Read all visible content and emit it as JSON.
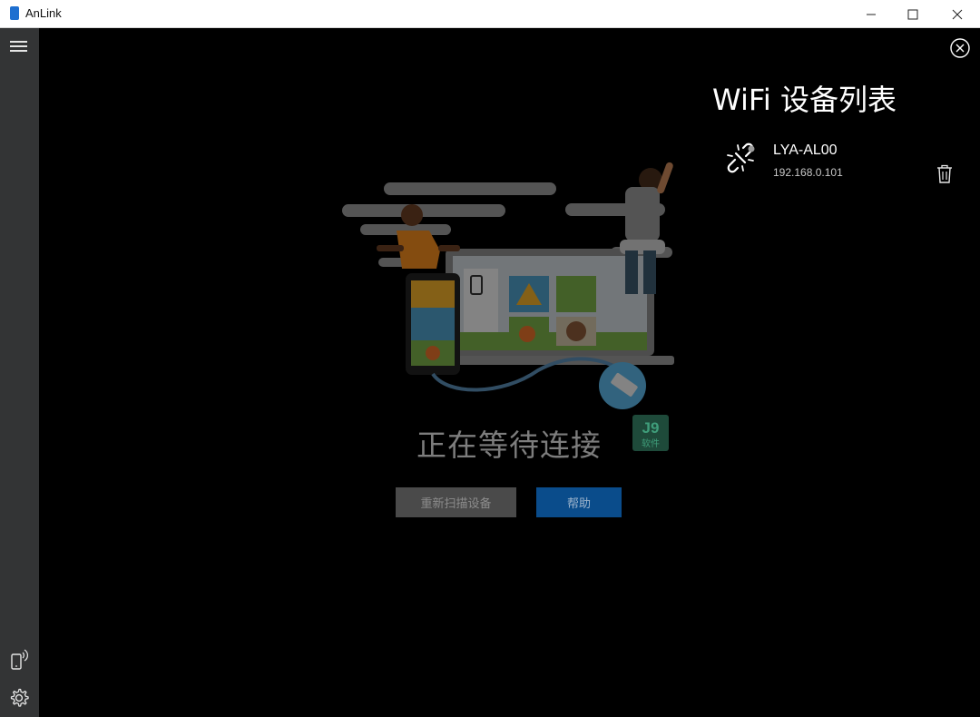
{
  "window": {
    "title": "AnLink",
    "minimize_icon": "minimize-icon",
    "maximize_icon": "maximize-icon",
    "close_icon": "close-icon"
  },
  "sidebar": {
    "menu_icon": "hamburger-menu-icon",
    "phone_icon": "phone-wireless-icon",
    "settings_icon": "gear-icon"
  },
  "main": {
    "status_text": "正在等待连接",
    "buttons": {
      "rescan": "重新扫描设备",
      "help": "帮助"
    },
    "watermark": "J9 软件"
  },
  "wifi_panel": {
    "title": "WiFi 设备列表",
    "close_icon": "circle-close-icon",
    "devices": [
      {
        "name": "LYA-AL00",
        "ip": "192.168.0.101",
        "icon": "broken-link-icon",
        "delete_icon": "trash-icon"
      }
    ]
  },
  "colors": {
    "sidebar": "#333435",
    "background": "#000000",
    "rescan_button": "#4a4a4a",
    "help_button": "#0a4c8b",
    "titlebar": "#ffffff"
  }
}
